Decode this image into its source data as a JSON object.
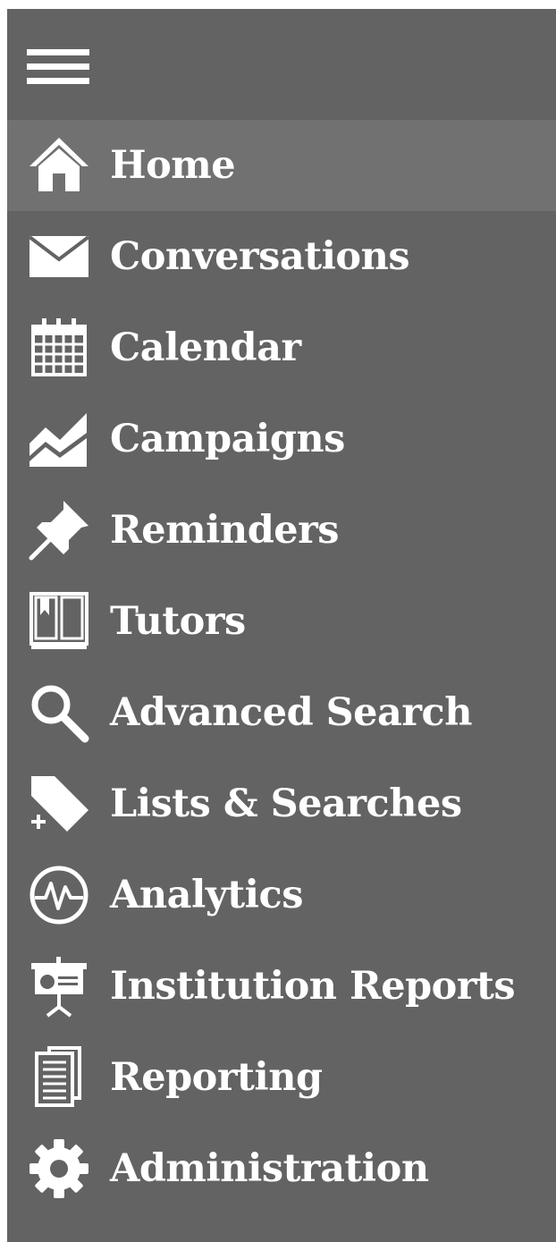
{
  "sidebar": {
    "menu_icon": "hamburger-menu-icon",
    "active_color": "#717171",
    "background_color": "#636363",
    "items": [
      {
        "label": "Home",
        "icon": "home-icon"
      },
      {
        "label": "Conversations",
        "icon": "envelope-icon"
      },
      {
        "label": "Calendar",
        "icon": "calendar-icon"
      },
      {
        "label": "Campaigns",
        "icon": "area-chart-icon"
      },
      {
        "label": "Reminders",
        "icon": "pushpin-icon"
      },
      {
        "label": "Tutors",
        "icon": "open-book-icon"
      },
      {
        "label": "Advanced Search",
        "icon": "search-icon"
      },
      {
        "label": "Lists & Searches",
        "icon": "tag-plus-icon"
      },
      {
        "label": "Analytics",
        "icon": "pulse-icon"
      },
      {
        "label": "Institution Reports",
        "icon": "presentation-board-icon"
      },
      {
        "label": "Reporting",
        "icon": "documents-icon"
      },
      {
        "label": "Administration",
        "icon": "gear-icon"
      }
    ]
  }
}
